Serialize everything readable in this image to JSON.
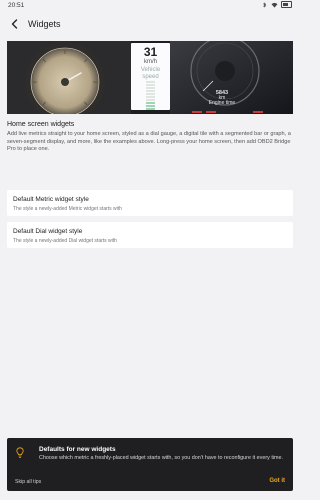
{
  "status_bar": {
    "time": "20:51"
  },
  "app_bar": {
    "title": "Widgets"
  },
  "hero": {
    "digital_tile": {
      "value": "31",
      "unit": "km/h",
      "label_line1": "Vehicle",
      "label_line2": "speed",
      "level_fraction": 0.3
    },
    "odometer": {
      "value": "5843",
      "unit": "km",
      "label": "Engine time"
    }
  },
  "home_screen": {
    "title": "Home screen widgets",
    "description": "Add live metrics straight to your home screen, styled as a dial gauge, a digital tile with a segmented bar or graph, a seven-segment display, and more, like the examples above. Long-press your home screen, then add OBD2 Bridge Pro to place one."
  },
  "cards": [
    {
      "title": "Default Metric widget style",
      "subtitle": "The style a newly-added Metric widget starts with"
    },
    {
      "title": "Default Dial widget style",
      "subtitle": "The style a newly-added Dial widget starts with"
    }
  ],
  "tip": {
    "title": "Defaults for new widgets",
    "description": "Choose which metric a freshly-placed widget starts with, so you don't have to reconfigure it every time.",
    "skip_label": "Skip all tips",
    "got_it_label": "Got it"
  },
  "colors": {
    "accent": "#f0a91c",
    "tip_bg": "#1f1f21",
    "page_bg": "#f2f2f5"
  }
}
